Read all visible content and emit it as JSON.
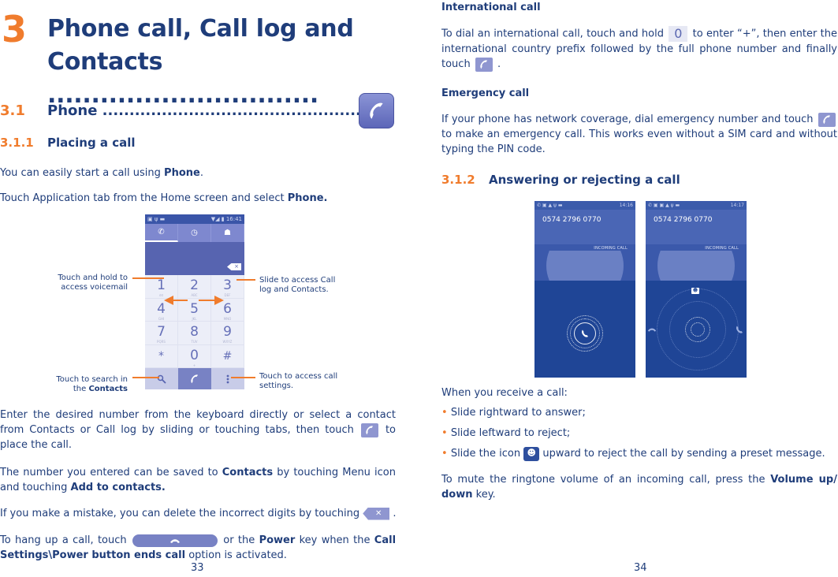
{
  "left_page": {
    "chapter_number": "3",
    "chapter_title": "Phone call, Call log and Contacts ...............................",
    "sections": {
      "s31": {
        "number": "3.1",
        "title": "Phone ......................................................"
      },
      "s311": {
        "number": "3.1.1",
        "title": "Placing a call"
      }
    },
    "paragraphs": {
      "p1_pre": "You can easily start a call using ",
      "p1_bold": "Phone",
      "p1_post": ".",
      "p2_pre": "Touch Application tab from the Home screen and select ",
      "p2_bold": "Phone.",
      "p3_pre": "Enter the desired number from the keyboard directly or select a contact from Contacts or Call log by sliding or touching tabs, then touch ",
      "p3_post": " to place the call.",
      "p4_pre": "The number you entered can be saved to ",
      "p4_bold1": "Contacts",
      "p4_mid": " by touching Menu icon and touching ",
      "p4_bold2": "Add to contacts.",
      "p5_pre": "If you make a mistake, you can delete the incorrect digits by touching ",
      "p5_post": " .",
      "p6_pre": "To hang up a call, touch ",
      "p6_mid": " or the ",
      "p6_bold1": "Power",
      "p6_mid2": " key when the ",
      "p6_bold2": "Call Settings\\Power button ends call",
      "p6_post": " option is activated."
    },
    "dialer": {
      "status_time": "16:41",
      "status_left": "▣ ψ ▬",
      "status_right": "▼◢ ▮",
      "tabs": [
        "phone-tab",
        "call-log-tab",
        "contacts-tab"
      ],
      "delete_label": "×",
      "keys": [
        {
          "digit": "1",
          "letters": "σσ"
        },
        {
          "digit": "2",
          "letters": "ABC"
        },
        {
          "digit": "3",
          "letters": "DEF"
        },
        {
          "digit": "4",
          "letters": "GHI"
        },
        {
          "digit": "5",
          "letters": "JKL"
        },
        {
          "digit": "6",
          "letters": "MNO"
        },
        {
          "digit": "7",
          "letters": "PQRS"
        },
        {
          "digit": "8",
          "letters": "TUV"
        },
        {
          "digit": "9",
          "letters": "WXYZ"
        },
        {
          "digit": "*",
          "letters": ""
        },
        {
          "digit": "0",
          "letters": "+"
        },
        {
          "digit": "#",
          "letters": ""
        }
      ]
    },
    "callouts": {
      "voicemail": "Touch and hold to access voicemail",
      "search_pre": "Touch to search in the ",
      "search_bold": "Contacts",
      "slide": "Slide to access Call log and Contacts.",
      "settings": "Touch to access call settings."
    },
    "page_number": "33"
  },
  "right_page": {
    "international": {
      "heading": "International call",
      "p_pre": "To dial an international call, touch and hold ",
      "zero_key": "0",
      "p_mid": " to enter “+”, then enter the international country prefix followed by the full phone number and finally touch ",
      "p_post": " ."
    },
    "emergency": {
      "heading": "Emergency call",
      "p_pre": "If your phone has network coverage, dial emergency number and touch ",
      "p_post": " to make an emergency call. This works even without a SIM card and without typing the PIN code."
    },
    "section_312": {
      "number": "3.1.2",
      "title": "Answering or rejecting a call"
    },
    "incoming_screens": [
      {
        "time": "14:16",
        "number": "0574 2796 0770",
        "label": "INCOMING CALL"
      },
      {
        "time": "14:17",
        "number": "0574 2796 0770",
        "label": "INCOMING CALL"
      }
    ],
    "receive_intro": "When you receive a call:",
    "bullets": [
      "Slide rightward to answer;",
      "Slide leftward to reject;"
    ],
    "bullet3_pre": "Slide the icon ",
    "bullet3_post": " upward to reject the call by sending a preset message.",
    "mute_pre": "To mute the ringtone volume of an incoming call, press the ",
    "mute_bold": "Volume up/ down",
    "mute_post": " key.",
    "page_number": "34"
  },
  "colors": {
    "text": "#1f3d7a",
    "accent_orange": "#f07c2d",
    "icon_purple": "#8f96d0",
    "screen_blue": "#1f4596"
  }
}
